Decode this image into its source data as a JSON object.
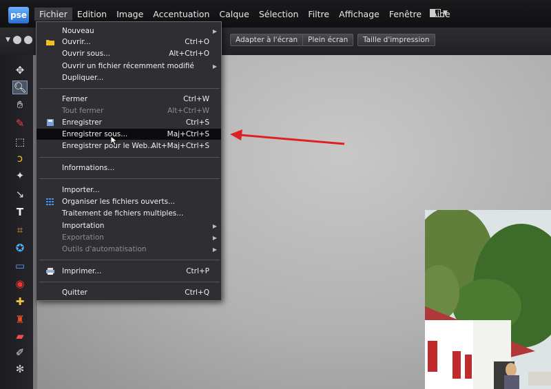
{
  "app": {
    "logo_text": "pse"
  },
  "menubar": {
    "items": [
      "Fichier",
      "Edition",
      "Image",
      "Accentuation",
      "Calque",
      "Sélection",
      "Filtre",
      "Affichage",
      "Fenêtre",
      "Aide"
    ]
  },
  "optionsbar": {
    "buttons": [
      "Adapter à l'écran",
      "Plein écran",
      "Taille d'impression"
    ]
  },
  "file_menu": {
    "nouveau": "Nouveau",
    "ouvrir": "Ouvrir...",
    "ouvrir_sc": "Ctrl+O",
    "ouvrir_sous": "Ouvrir sous...",
    "ouvrir_sous_sc": "Alt+Ctrl+O",
    "recent": "Ouvrir un fichier récemment modifié",
    "dupliquer": "Dupliquer...",
    "fermer": "Fermer",
    "fermer_sc": "Ctrl+W",
    "tout_fermer": "Tout fermer",
    "tout_fermer_sc": "Alt+Ctrl+W",
    "enregistrer": "Enregistrer",
    "enregistrer_sc": "Ctrl+S",
    "enregistrer_sous": "Enregistrer sous...",
    "enregistrer_sous_sc": "Maj+Ctrl+S",
    "enregistrer_web": "Enregistrer pour le Web...",
    "enregistrer_web_sc": "Alt+Maj+Ctrl+S",
    "informations": "Informations...",
    "importer": "Importer...",
    "organiser": "Organiser les fichiers ouverts...",
    "traitement": "Traitement de fichiers multiples...",
    "importation": "Importation",
    "exportation": "Exportation",
    "outils_auto": "Outils d'automatisation",
    "imprimer": "Imprimer...",
    "imprimer_sc": "Ctrl+P",
    "quitter": "Quitter",
    "quitter_sc": "Ctrl+Q"
  },
  "colors": {
    "highlight": "#0c0c0e",
    "arrow": "#e02020",
    "accent": "#2a6fd0"
  }
}
